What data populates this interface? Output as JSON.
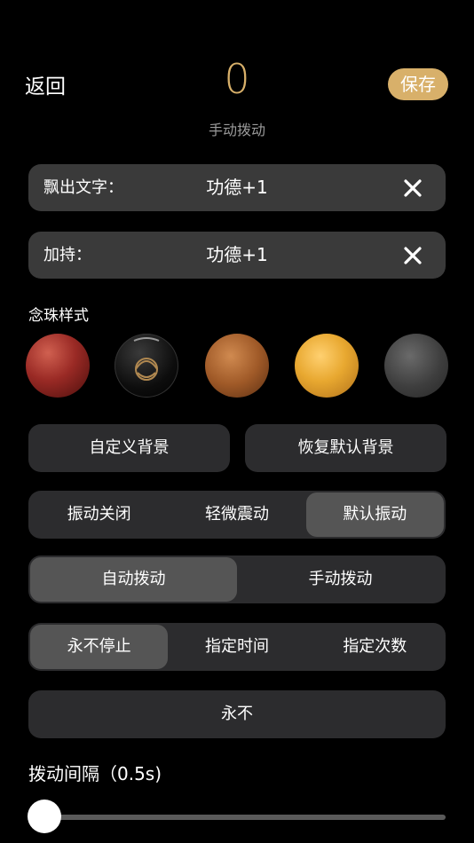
{
  "header": {
    "back_label": "返回",
    "count": "0",
    "mode_label": "手动拨动",
    "save_label": "保存"
  },
  "float_text": {
    "label": "飘出文字：",
    "value": "功德+1"
  },
  "blessing": {
    "label": "加持：",
    "value": "功德+1"
  },
  "bead_style": {
    "title": "念珠样式",
    "beads": [
      "red-sandalwood",
      "black-obsidian",
      "bodhi-seed",
      "amber",
      "grey-stone"
    ]
  },
  "background_buttons": {
    "custom": "自定义背景",
    "restore": "恢复默认背景"
  },
  "vibration": {
    "options": [
      "振动关闭",
      "轻微震动",
      "默认振动"
    ],
    "selected": 2
  },
  "spin_mode": {
    "options": [
      "自动拨动",
      "手动拨动"
    ],
    "selected": 0
  },
  "stop_mode": {
    "options": [
      "永不停止",
      "指定时间",
      "指定次数"
    ],
    "selected": 0
  },
  "stop_value": "永不",
  "interval": {
    "label": "拨动间隔（0.5s)",
    "slider_value": 0
  },
  "colors": {
    "accent": "#d8b06a",
    "background": "#000000"
  }
}
